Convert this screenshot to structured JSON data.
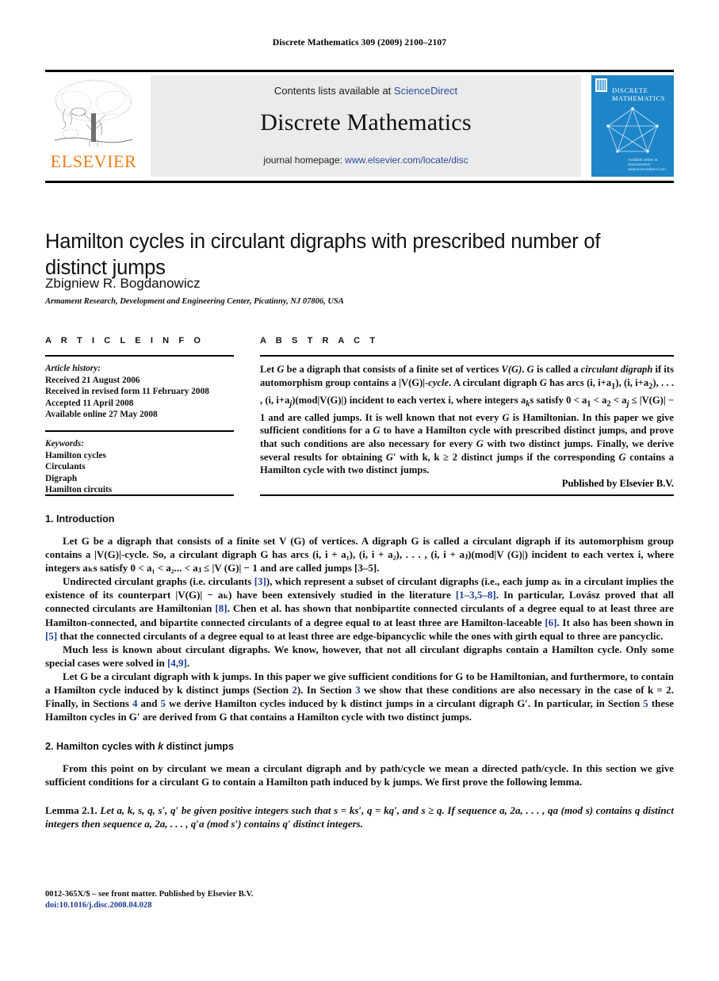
{
  "running_head": "Discrete Mathematics 309 (2009) 2100–2107",
  "masthead": {
    "contents_prefix": "Contents lists available at ",
    "sciencedirect": "ScienceDirect",
    "journal_name": "Discrete Mathematics",
    "homepage_prefix": "journal homepage: ",
    "homepage_url": "www.elsevier.com/locate/disc",
    "publisher_logo_text": "ELSEVIER",
    "cover_title": "DISCRETE MATHEMATICS",
    "cover_footer": "Available online at ScienceDirect www.sciencedirect.com",
    "link_color": "#2a4b9b",
    "elsevier_orange": "#f07d18",
    "cover_blue": "#1e85c8"
  },
  "article": {
    "title": "Hamilton cycles in circulant digraphs with prescribed number of distinct jumps",
    "author": "Zbigniew R. Bogdanowicz",
    "affiliation": "Armament Research, Development and Engineering Center, Picatinny, NJ 07806, USA"
  },
  "article_info": {
    "heading": "A R T I C L E   I N F O",
    "history_label": "Article history:",
    "history": [
      "Received 21 August 2006",
      "Received in revised form 11 February 2008",
      "Accepted 11 April 2008",
      "Available online 27 May 2008"
    ],
    "keywords_label": "Keywords:",
    "keywords": [
      "Hamilton cycles",
      "Circulants",
      "Digraph",
      "Hamilton circuits"
    ]
  },
  "abstract": {
    "heading": "A B S T R A C T",
    "p1_a": "Let ",
    "p1_G": "G",
    "p1_b": " be a digraph that consists of a finite set of vertices ",
    "p1_VG": "V(G)",
    "p1_c": ". ",
    "p1_G2": "G",
    "p1_d": " is called a ",
    "p1_em1": "circulant digraph",
    "p1_e": " if its automorphism group contains a |V(G)|-",
    "p1_em2": "cycle",
    "p1_f": ". A circulant digraph ",
    "p1_G3": "G",
    "p1_g": " has arcs (i, i+a",
    "p1_sub1": "1",
    "p1_h": "), (i, i+a",
    "p1_sub2": "2",
    "p1_i": "), . . . , (i, i+a",
    "p1_subj": "j",
    "p1_j": ")(mod|V(G)|) incident to each vertex i, where integers a",
    "p1_subk": "k",
    "p1_k": "s satisfy 0 < a",
    "p1_l": " < a",
    "p1_m": " < a",
    "p1_n": " ≤ |V(G)| − 1 and are called jumps. It is well known that not every ",
    "p1_G4": "G",
    "p1_o": " is Hamiltonian. In this paper we give sufficient conditions for a ",
    "p1_G5": "G",
    "p1_p": " to have a Hamilton cycle with prescribed distinct jumps, and prove that such conditions are also necessary for every ",
    "p1_G6": "G",
    "p1_q": " with two distinct jumps. Finally, we derive several results for obtaining ",
    "p1_Gp": "G′",
    "p1_r": " with k, k ≥ 2 distinct jumps if the corresponding ",
    "p1_G7": "G",
    "p1_s": " contains a Hamilton cycle with two distinct jumps.",
    "published_by": "Published by Elsevier B.V."
  },
  "sections": {
    "s1_number_title": "1.  Introduction",
    "s2_number_title_a": "2.  Hamilton cycles with ",
    "s2_k": "k",
    "s2_number_title_b": " distinct jumps"
  },
  "intro": {
    "p1": "Let G be a digraph that consists of a finite set V (G) of vertices. A digraph G is called a circulant digraph if its automorphism group contains a |V(G)|-cycle. So, a circulant digraph G has arcs (i, i + a₁), (i, i + a₂), . . . , (i, i + aⱼ)(mod|V (G)|) incident to each vertex i, where integers aₖs satisfy 0 < a₁ < a₂... < aⱼ ≤ |V (G)| − 1 and are called jumps [3–5].",
    "p1_ref": "[3–5]",
    "p2_a": "Undirected circulant graphs (i.e. circulants ",
    "p2_ref1": "[3]",
    "p2_b": "), which represent a subset of circulant digraphs (i.e., each jump aₖ in a circulant implies the existence of its counterpart |V(G)| − aₖ) have been extensively studied in the literature ",
    "p2_ref2": "[1–3,5–8]",
    "p2_c": ". In particular, Lovász proved that all connected circulants are Hamiltonian ",
    "p2_ref3": "[8]",
    "p2_d": ". Chen et al. has shown that nonbipartite connected circulants of a degree equal to at least three are Hamilton-connected, and bipartite connected circulants of a degree equal to at least three are Hamilton-laceable ",
    "p2_ref4": "[6]",
    "p2_e": ". It also has been shown in ",
    "p2_ref5": "[5]",
    "p2_f": " that the connected circulants of a degree equal to at least three are edge-bipancyclic while the ones with girth equal to three are pancyclic.",
    "p3_a": "Much less is known about circulant digraphs. We know, however, that not all circulant digraphs contain a Hamilton cycle. Only some special cases were solved in ",
    "p3_ref": "[4,9]",
    "p3_b": ".",
    "p4_a": "Let G be a circulant digraph with k jumps. In this paper we give sufficient conditions for G to be Hamiltonian, and furthermore, to contain a Hamilton cycle induced by k distinct jumps (Section ",
    "p4_ref1": "2",
    "p4_b": "). In Section ",
    "p4_ref2": "3",
    "p4_c": " we show that these conditions are also necessary in the case of k = 2. Finally, in Sections ",
    "p4_ref3": "4",
    "p4_d": " and ",
    "p4_ref4": "5",
    "p4_e": " we derive Hamilton cycles induced by k distinct jumps in a circulant digraph G′. In particular, in Section ",
    "p4_ref5": "5",
    "p4_f": " these Hamilton cycles in G′ are derived from G that contains a Hamilton cycle with two distinct jumps."
  },
  "section2": {
    "p1": "From this point on by circulant we mean a circulant digraph and by path/cycle we mean a directed path/cycle. In this section we give sufficient conditions for a circulant G to contain a Hamilton path induced by k jumps. We first prove the following lemma.",
    "lemma_label": "Lemma 2.1.",
    "lemma_text": "Let a, k, s, q, s′, q′ be given positive integers such that s = ks′, q = kq′, and s ≥ q. If sequence a, 2a, . . . , qa (mod s) contains q distinct integers then sequence a, 2a, . . . , q′a (mod s′) contains q′ distinct integers."
  },
  "footer": {
    "copyright": "0012-365X/$ – see front matter. Published by Elsevier B.V.",
    "doi": "doi:10.1016/j.disc.2008.04.028"
  }
}
